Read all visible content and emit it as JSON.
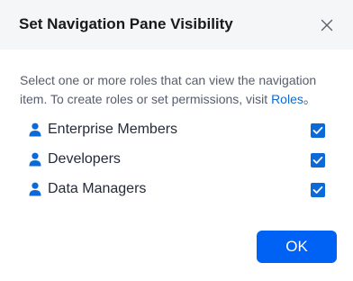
{
  "dialog": {
    "title": "Set Navigation Pane Visibility",
    "description_prefix": "Select one or more roles that can view the navigation item. To create roles or set permissions, visit ",
    "description_link": "Roles",
    "description_suffix": "。",
    "roles": [
      {
        "label": "Enterprise Members",
        "checked": true,
        "icon": "user-icon"
      },
      {
        "label": "Developers",
        "checked": true,
        "icon": "user-icon"
      },
      {
        "label": "Data Managers",
        "checked": true,
        "icon": "user-icon"
      }
    ],
    "ok_label": "OK",
    "close_icon": "close-icon",
    "colors": {
      "accent": "#0b6ad8",
      "button": "#0062f4",
      "header_bg": "#f5f6f8"
    }
  }
}
